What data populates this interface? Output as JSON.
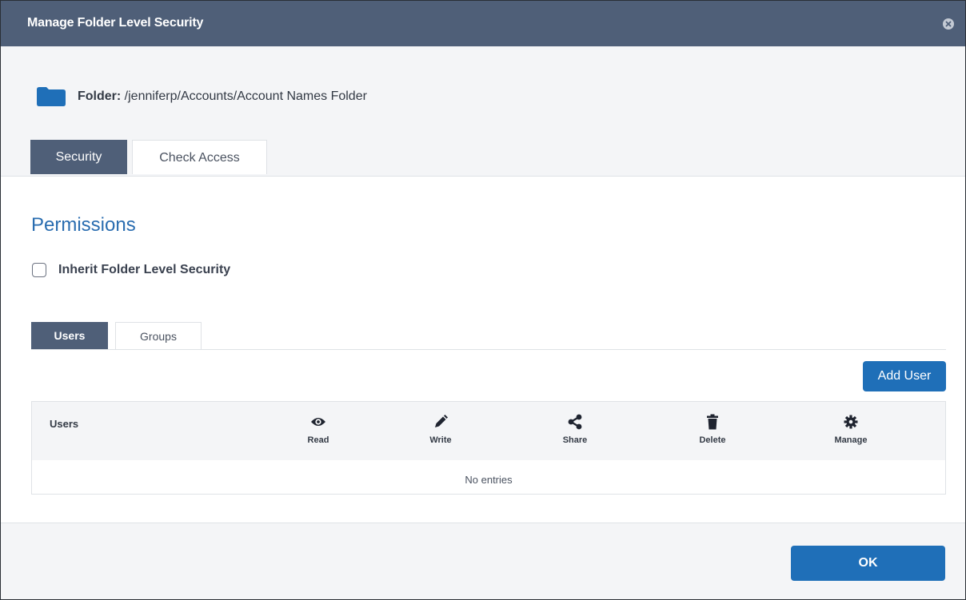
{
  "dialog": {
    "title": "Manage Folder Level Security",
    "close_icon": "close-circle-icon"
  },
  "folder": {
    "icon": "folder-icon",
    "label": "Folder:",
    "path": "/jenniferp/Accounts/Account Names Folder"
  },
  "tabs": [
    {
      "label": "Security",
      "active": true
    },
    {
      "label": "Check Access",
      "active": false
    }
  ],
  "permissions": {
    "title": "Permissions",
    "inherit_label": "Inherit Folder Level Security",
    "inherit_checked": false
  },
  "subtabs": [
    {
      "label": "Users",
      "active": true
    },
    {
      "label": "Groups",
      "active": false
    }
  ],
  "add_user_label": "Add User",
  "grid": {
    "users_header": "Users",
    "columns": [
      {
        "label": "Read",
        "icon": "eye-icon"
      },
      {
        "label": "Write",
        "icon": "pencil-icon"
      },
      {
        "label": "Share",
        "icon": "share-icon"
      },
      {
        "label": "Delete",
        "icon": "trash-icon"
      },
      {
        "label": "Manage",
        "icon": "gear-icon"
      }
    ],
    "empty_text": "No entries"
  },
  "footer": {
    "ok_label": "OK"
  },
  "colors": {
    "header_bg": "#4f5f78",
    "accent_blue": "#1f6fb8",
    "title_blue": "#2a6db0"
  }
}
